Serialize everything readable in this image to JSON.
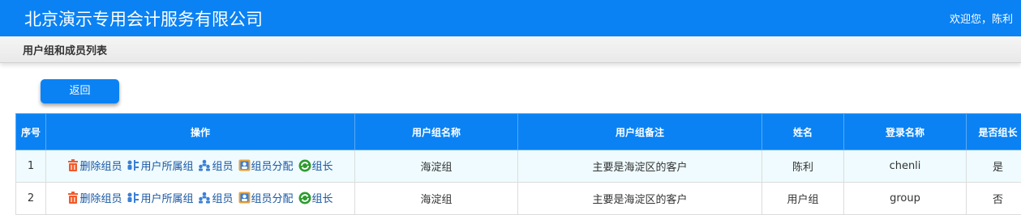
{
  "header": {
    "title": "北京演示专用会计服务有限公司",
    "welcome": "欢迎您，陈利"
  },
  "subheader": {
    "title": "用户组和成员列表"
  },
  "back_button": {
    "label": "返回"
  },
  "table": {
    "columns": [
      "序号",
      "操作",
      "用户组名称",
      "用户组备注",
      "姓名",
      "登录名称",
      "是否组长"
    ],
    "actions": [
      "删除组员",
      "用户所属组",
      "组员",
      "组员分配",
      "组长"
    ],
    "rows": [
      {
        "index": "1",
        "group_name": "海淀组",
        "group_note": "主要是海淀区的客户",
        "name": "陈利",
        "login": "chenli",
        "is_leader": "是"
      },
      {
        "index": "2",
        "group_name": "海淀组",
        "group_note": "主要是海淀区的客户",
        "name": "用户组",
        "login": "group",
        "is_leader": "否"
      }
    ]
  },
  "colors": {
    "primary": "#0a82f4",
    "row_highlight": "#effbfe",
    "link": "#1a57a4",
    "delete_icon": "#f25a2a",
    "leader_icon": "#2e9b2e"
  }
}
